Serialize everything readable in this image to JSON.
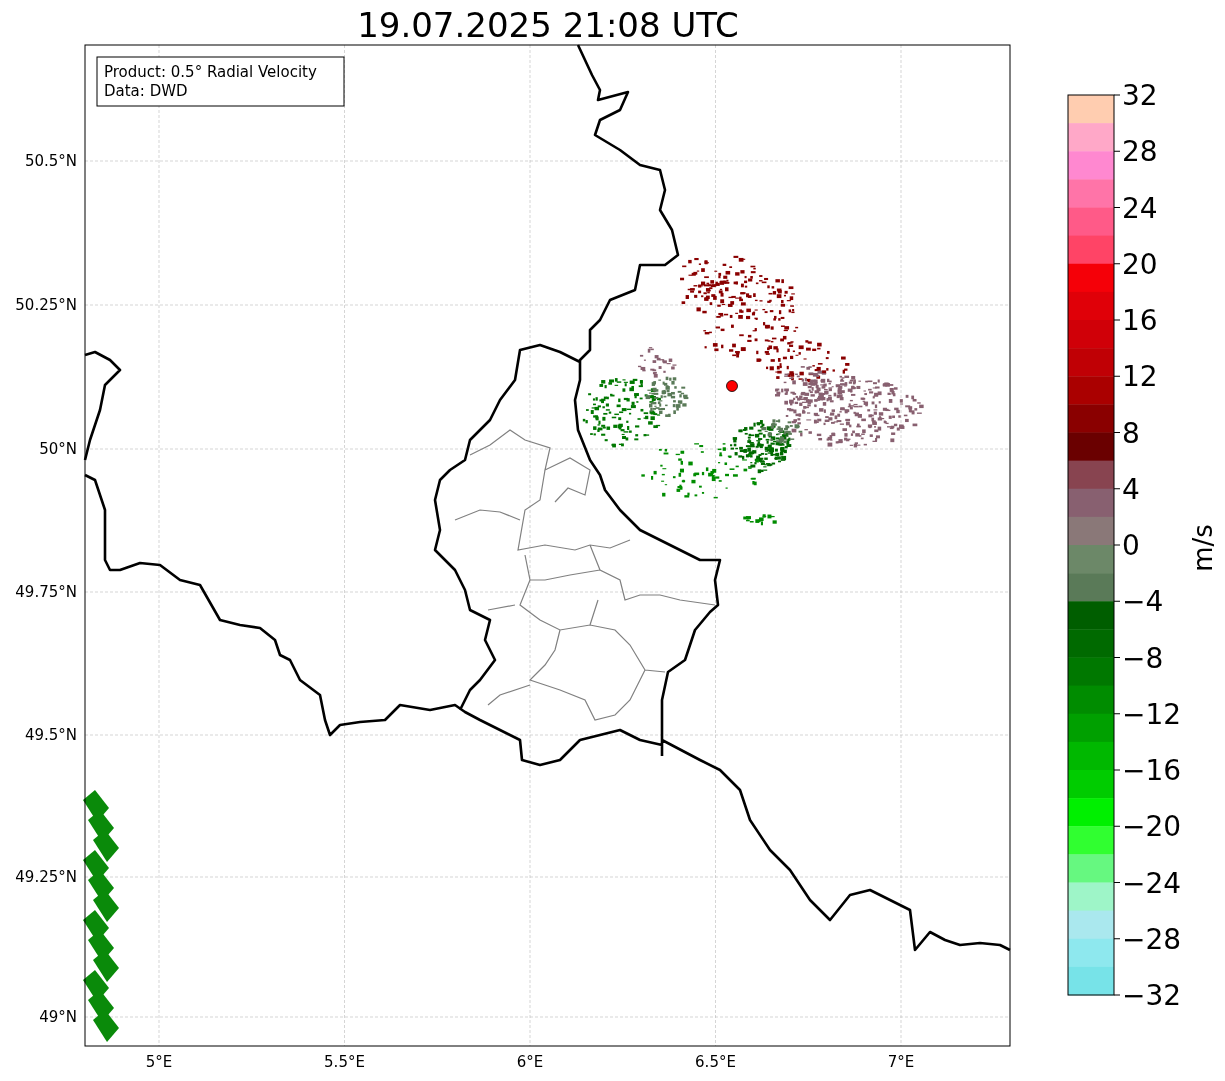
{
  "title": "19.07.2025 21:08 UTC",
  "info_box": [
    "Product: 0.5° Radial Velocity",
    "Data: DWD"
  ],
  "map": {
    "xticks": [
      "5°E",
      "5.5°E",
      "6°E",
      "6.5°E",
      "7°E"
    ],
    "yticks": [
      "50.5°N",
      "50.25°N",
      "50°N",
      "49.75°N",
      "49.5°N",
      "49.25°N",
      "49°N"
    ]
  },
  "colorbar": {
    "label": "m/s",
    "ticks": [
      "32",
      "28",
      "24",
      "20",
      "16",
      "12",
      "8",
      "4",
      "0",
      "−4",
      "−8",
      "−12",
      "−16",
      "−20",
      "−24",
      "−28",
      "−32"
    ],
    "bands": [
      {
        "color": "#ffcdb0"
      },
      {
        "color": "#ffa8c8"
      },
      {
        "color": "#ff88d0"
      },
      {
        "color": "#ff74a8"
      },
      {
        "color": "#ff5a88"
      },
      {
        "color": "#ff4466"
      },
      {
        "color": "#f50008"
      },
      {
        "color": "#e00008"
      },
      {
        "color": "#d00008"
      },
      {
        "color": "#c00005"
      },
      {
        "color": "#aa0000"
      },
      {
        "color": "#8a0000"
      },
      {
        "color": "#6a0000"
      },
      {
        "color": "#884450"
      },
      {
        "color": "#886070"
      },
      {
        "color": "#8a7878"
      },
      {
        "color": "#6c8868"
      },
      {
        "color": "#5a7a58"
      },
      {
        "color": "#005e00"
      },
      {
        "color": "#006a00"
      },
      {
        "color": "#007800"
      },
      {
        "color": "#008c00"
      },
      {
        "color": "#00a000"
      },
      {
        "color": "#00b800"
      },
      {
        "color": "#00cc00"
      },
      {
        "color": "#00f000"
      },
      {
        "color": "#30ff30"
      },
      {
        "color": "#66f880"
      },
      {
        "color": "#9ef5c8"
      },
      {
        "color": "#aae8ee"
      },
      {
        "color": "#8ee8ee"
      },
      {
        "color": "#77e3e8"
      }
    ]
  }
}
